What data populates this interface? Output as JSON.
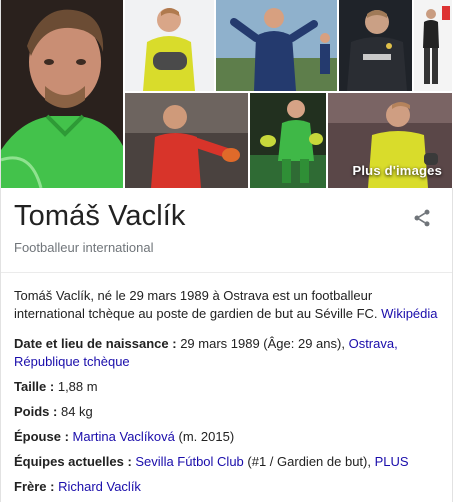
{
  "images": {
    "more_label": "Plus d'images"
  },
  "header": {
    "title": "Tomáš Vaclík",
    "subtitle": "Footballeur international",
    "share_icon": "share-icon"
  },
  "description": {
    "text": "Tomáš Vaclík, né le 29 mars 1989 à Ostrava est un footballeur international tchèque au poste de gardien de but au Séville FC.",
    "source_link": "Wikipédia"
  },
  "facts": {
    "birth": {
      "label": "Date et lieu de naissance",
      "value": "29 mars 1989 (Âge: 29 ans),",
      "link1": "Ostrava,",
      "link2": "République tchèque"
    },
    "height": {
      "label": "Taille",
      "value": "1,88 m"
    },
    "weight": {
      "label": "Poids",
      "value": "84 kg"
    },
    "spouse": {
      "label": "Épouse",
      "link": "Martina Vaclíková",
      "value": "(m. 2015)"
    },
    "teams": {
      "label": "Équipes actuelles",
      "link": "Sevilla Fútbol Club",
      "value": "(#1 / Gardien de but),",
      "more": "PLUS"
    },
    "brother": {
      "label": "Frère",
      "link": "Richard Vaclík"
    }
  },
  "colors": {
    "link": "#1a0dab",
    "text": "#222222",
    "muted": "#70757a",
    "keeper_green": "#3fb847",
    "keeper_red": "#d8342a",
    "keeper_yellow": "#d9dc2b"
  }
}
